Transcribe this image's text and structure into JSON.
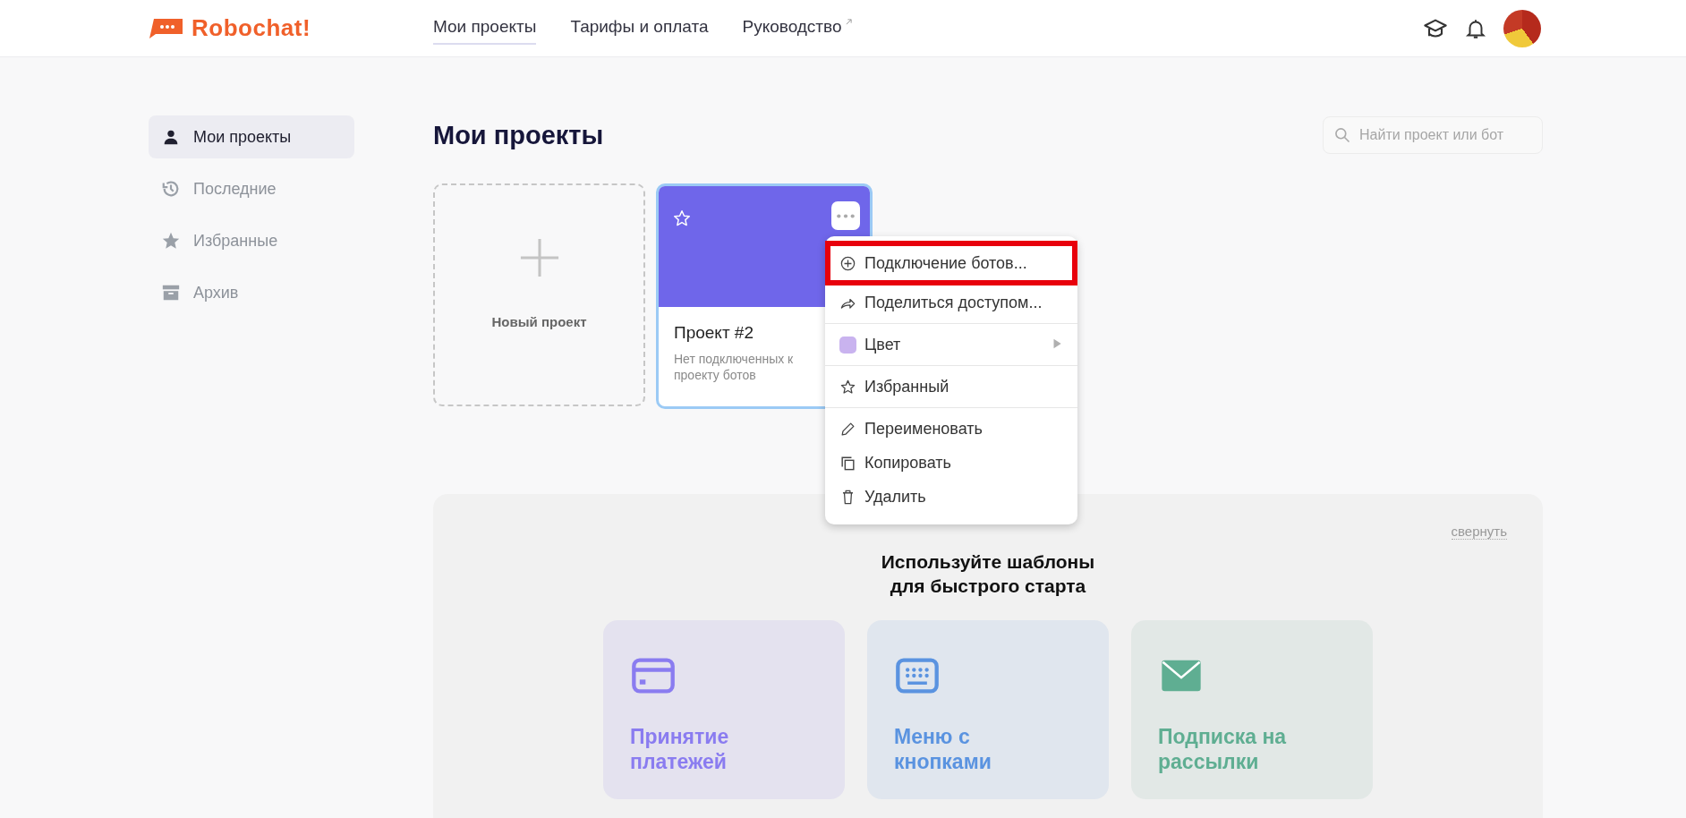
{
  "header": {
    "logo": "Robochat!",
    "nav": [
      {
        "label": "Мои проекты",
        "selected": true,
        "external": false
      },
      {
        "label": "Тарифы и оплата",
        "selected": false,
        "external": false
      },
      {
        "label": "Руководство",
        "selected": false,
        "external": true
      }
    ]
  },
  "sidebar": {
    "items": [
      {
        "label": "Мои проекты",
        "selected": true
      },
      {
        "label": "Последние",
        "selected": false
      },
      {
        "label": "Избранные",
        "selected": false
      },
      {
        "label": "Архив",
        "selected": false
      }
    ]
  },
  "page": {
    "title": "Мои проекты",
    "search": {
      "placeholder": "Найти проект или бот"
    }
  },
  "new_project": {
    "label": "Новый проект"
  },
  "projects": [
    {
      "name": "Проект #2",
      "description": "Нет подключенных к проекту ботов",
      "color": "#6f66ea",
      "favorite": false,
      "selected": true
    }
  ],
  "context_menu": {
    "groups": [
      {
        "items": [
          {
            "kind": "action",
            "label": "Подключение ботов...",
            "highlighted": true
          },
          {
            "kind": "action",
            "label": "Поделиться доступом...",
            "highlighted": false
          }
        ]
      },
      {
        "items": [
          {
            "kind": "color",
            "label": "Цвет",
            "color": "#c9b3ef",
            "highlighted": false
          }
        ]
      },
      {
        "items": [
          {
            "kind": "action",
            "label": "Избранный",
            "highlighted": false
          }
        ]
      },
      {
        "items": [
          {
            "kind": "action",
            "label": "Переименовать",
            "highlighted": false
          },
          {
            "kind": "action",
            "label": "Копировать",
            "highlighted": false
          },
          {
            "kind": "action",
            "label": "Удалить",
            "highlighted": false
          }
        ]
      }
    ]
  },
  "templates": {
    "collapse": "свернуть",
    "heading": "Используйте шаблоны\nдля быстрого старта",
    "cards": [
      {
        "label": "Принятие платежей",
        "color": "#8a7cf0"
      },
      {
        "label": "Меню с кнопками",
        "color": "#5a93e0"
      },
      {
        "label": "Подписка на рассылки",
        "color": "#5fae92"
      }
    ]
  }
}
